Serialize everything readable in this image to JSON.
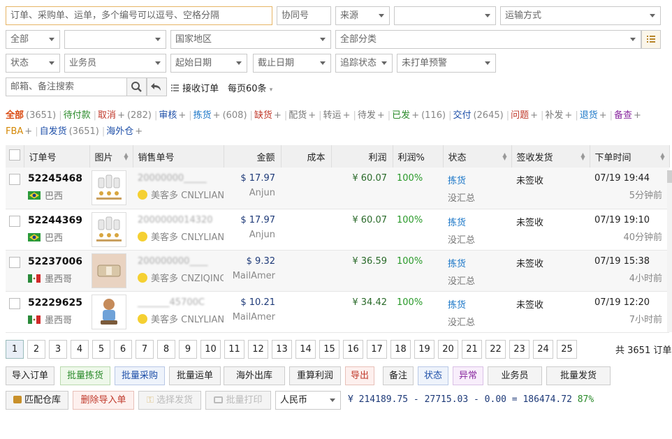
{
  "filters": {
    "order_search_placeholder": "订单、采购单、运单，多个编号可以逗号、空格分隔",
    "coop_placeholder": "协同号",
    "source": "来源",
    "blank1": "",
    "shipping": "运输方式",
    "all": "全部",
    "blank2": "",
    "region": "国家地区",
    "category": "全部分类",
    "status": "状态",
    "salesman": "业务员",
    "start_date": "起始日期",
    "end_date": "截止日期",
    "track_status": "追踪状态",
    "not_printed": "未打单预警",
    "email_placeholder": "邮箱、备注搜索",
    "receive_order": "接收订单",
    "per_page": "每页60条"
  },
  "tabs": [
    {
      "label": "全部",
      "count": "(3651)",
      "color": "#d9480f",
      "plus": ""
    },
    {
      "label": "待付款",
      "count": "",
      "color": "#2a8a2a",
      "plus": ""
    },
    {
      "label": "取消",
      "count": "(282)",
      "color": "#c0392b",
      "plus": "+"
    },
    {
      "label": "审核",
      "count": "",
      "color": "#1e4fa8",
      "plus": "+"
    },
    {
      "label": "拣货",
      "count": "(608)",
      "color": "#1e78c8",
      "plus": "+"
    },
    {
      "label": "缺货",
      "count": "",
      "color": "#c0392b",
      "plus": "+"
    },
    {
      "label": "配货",
      "count": "",
      "color": "#777",
      "plus": "+"
    },
    {
      "label": "转运",
      "count": "",
      "color": "#777",
      "plus": "+"
    },
    {
      "label": "待发",
      "count": "",
      "color": "#777",
      "plus": "+"
    },
    {
      "label": "已发",
      "count": "(116)",
      "color": "#2a8a2a",
      "plus": "+"
    },
    {
      "label": "交付",
      "count": "(2645)",
      "color": "#1e4fa8",
      "plus": ""
    },
    {
      "label": "问题",
      "count": "",
      "color": "#c0392b",
      "plus": "+"
    },
    {
      "label": "补发",
      "count": "",
      "color": "#777",
      "plus": "+"
    },
    {
      "label": "退货",
      "count": "",
      "color": "#1e78c8",
      "plus": "+"
    },
    {
      "label": "备查",
      "count": "",
      "color": "#8a2aa0",
      "plus": "+"
    },
    {
      "label": "FBA",
      "count": "",
      "color": "#d48806",
      "plus": "+"
    },
    {
      "label": "自发货",
      "count": "(3651)",
      "color": "#1e4fa8",
      "plus": ""
    },
    {
      "label": "海外仓",
      "count": "",
      "color": "#1e4fa8",
      "plus": "+"
    }
  ],
  "columns": {
    "order_no": "订单号",
    "image": "图片",
    "sales_no": "销售单号",
    "amount": "金额",
    "cost": "成本",
    "profit": "利润",
    "profit_pct": "利润%",
    "status": "状态",
    "sign": "签收发货",
    "order_time": "下单时间"
  },
  "orders": [
    {
      "id": "52245468",
      "country": "巴西",
      "flag": "br",
      "sales_no": "20000000_____",
      "shop": "美客多 CNLYLIANN",
      "carrier": "Anjun",
      "amount": "$ 17.97",
      "profit": "¥ 60.07",
      "profit_pct": "100%",
      "status": "拣货",
      "status2": "没汇总",
      "sign": "未签收",
      "time": "07/19 19:44",
      "ago": "5分钟前",
      "thumb": "bottles"
    },
    {
      "id": "52244369",
      "country": "巴西",
      "flag": "br",
      "sales_no": "2000000014320",
      "shop": "美客多 CNLYLIANN",
      "carrier": "Anjun",
      "amount": "$ 17.97",
      "profit": "¥ 60.07",
      "profit_pct": "100%",
      "status": "拣货",
      "status2": "没汇总",
      "sign": "未签收",
      "time": "07/19 19:10",
      "ago": "40分钟前",
      "thumb": "bottles"
    },
    {
      "id": "52237006",
      "country": "墨西哥",
      "flag": "mx",
      "sales_no": "200000000____",
      "shop": "美客多 CNZIQING",
      "carrier": "MailAmer",
      "amount": "$ 9.32",
      "profit": "¥ 36.59",
      "profit_pct": "100%",
      "status": "拣货",
      "status2": "没汇总",
      "sign": "未签收",
      "time": "07/19 15:38",
      "ago": "4小时前",
      "thumb": "belt"
    },
    {
      "id": "52229625",
      "country": "墨西哥",
      "flag": "mx",
      "sales_no": "_______45700C",
      "shop": "美客多 CNLYLIANN",
      "carrier": "MailAmer",
      "amount": "$ 10.21",
      "profit": "¥ 34.42",
      "profit_pct": "100%",
      "status": "拣货",
      "status2": "没汇总",
      "sign": "未签收",
      "time": "07/19 12:20",
      "ago": "7小时前",
      "thumb": "figure"
    }
  ],
  "pages": [
    "1",
    "2",
    "3",
    "4",
    "5",
    "6",
    "7",
    "8",
    "9",
    "10",
    "11",
    "12",
    "13",
    "14",
    "15",
    "16",
    "17",
    "18",
    "19",
    "20",
    "21",
    "22",
    "23",
    "24",
    "25"
  ],
  "total": "共 3651 订单",
  "actions1": [
    {
      "label": "导入订单",
      "style": ""
    },
    {
      "label": "批量拣货",
      "style": "g"
    },
    {
      "label": "批量采购",
      "style": "b"
    },
    {
      "label": "批量运单",
      "style": ""
    },
    {
      "label": "海外出库",
      "style": ""
    },
    {
      "label": "重算利润",
      "style": ""
    },
    {
      "label": "导出",
      "style": "r"
    },
    {
      "label": "备注",
      "style": ""
    },
    {
      "label": "状态",
      "style": "b"
    },
    {
      "label": "异常",
      "style": "p"
    },
    {
      "label": "业务员",
      "style": ""
    },
    {
      "label": "批量发货",
      "style": ""
    }
  ],
  "actions2": {
    "match_warehouse": "匹配仓库",
    "delete_import": "删除导入单",
    "select_ship": "选择发货",
    "batch_print": "批量打印",
    "currency": "人民币",
    "summary": "¥ 214189.75 - 27715.03 - 0.00 = 186474.72",
    "percent": "87%"
  }
}
